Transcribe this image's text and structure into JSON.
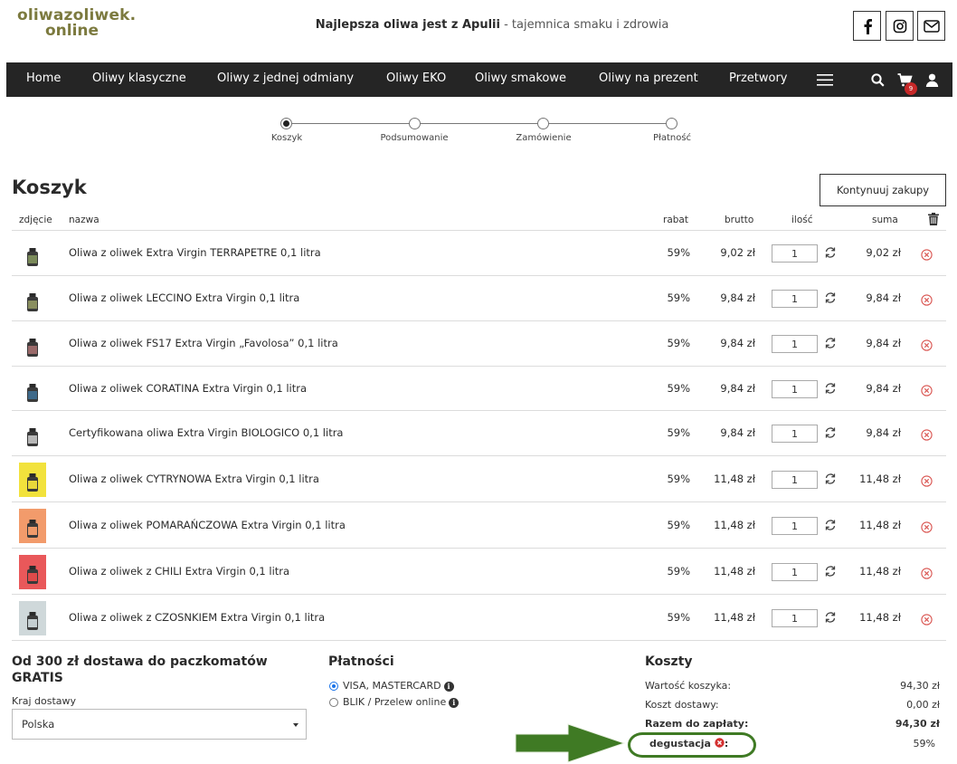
{
  "header": {
    "logo_line1": "oliwazoliwek.",
    "logo_line2": "online",
    "tagline_bold": "Najlepsza oliwa jest z Apulii",
    "tagline_rest": " - tajemnica smaku i zdrowia",
    "social": [
      "facebook-icon",
      "instagram-icon",
      "mail-icon"
    ]
  },
  "nav": {
    "items": [
      "Home",
      "Oliwy klasyczne",
      "Oliwy z jednej odmiany",
      "Oliwy EKO",
      "Oliwy smakowe",
      "Oliwy na prezent",
      "Przetwory"
    ],
    "cart_count": "9"
  },
  "steps": [
    "Koszyk",
    "Podsumowanie",
    "Zamówienie",
    "Płatność"
  ],
  "page_title": "Koszyk",
  "continue_label": "Kontynuuj zakupy",
  "table": {
    "headers": {
      "photo": "zdjęcie",
      "name": "nazwa",
      "rabat": "rabat",
      "brutto": "brutto",
      "qty": "ilość",
      "suma": "suma"
    },
    "rows": [
      {
        "name": "Oliwa z oliwek Extra Virgin TERRAPETRE 0,1 litra",
        "rabat": "59%",
        "brutto": "9,02 zł",
        "qty": "1",
        "suma": "9,02 zł",
        "label_color": "#7a8a5a",
        "bg": "#ffffff"
      },
      {
        "name": "Oliwa z oliwek LECCINO Extra Virgin 0,1 litra",
        "rabat": "59%",
        "brutto": "9,84 zł",
        "qty": "1",
        "suma": "9,84 zł",
        "label_color": "#8a8f60",
        "bg": "#ffffff"
      },
      {
        "name": "Oliwa z oliwek FS17 Extra Virgin „Favolosa” 0,1 litra",
        "rabat": "59%",
        "brutto": "9,84 zł",
        "qty": "1",
        "suma": "9,84 zł",
        "label_color": "#9a6a6a",
        "bg": "#ffffff"
      },
      {
        "name": "Oliwa z oliwek CORATINA Extra Virgin 0,1 litra",
        "rabat": "59%",
        "brutto": "9,84 zł",
        "qty": "1",
        "suma": "9,84 zł",
        "label_color": "#3f6a8a",
        "bg": "#ffffff"
      },
      {
        "name": "Certyfikowana oliwa Extra Virgin BIOLOGICO 0,1 litra",
        "rabat": "59%",
        "brutto": "9,84 zł",
        "qty": "1",
        "suma": "9,84 zł",
        "label_color": "#b8b8b8",
        "bg": "#ffffff"
      },
      {
        "name": "Oliwa z oliwek CYTRYNOWA Extra Virgin 0,1 litra",
        "rabat": "59%",
        "brutto": "11,48 zł",
        "qty": "1",
        "suma": "11,48 zł",
        "label_color": "#e8d83a",
        "bg": "#f2e23c"
      },
      {
        "name": "Oliwa z oliwek POMARAŃCZOWA Extra Virgin 0,1 litra",
        "rabat": "59%",
        "brutto": "11,48 zł",
        "qty": "1",
        "suma": "11,48 zł",
        "label_color": "#ef9a6a",
        "bg": "#f29b6b"
      },
      {
        "name": "Oliwa z oliwek z CHILI Extra Virgin 0,1 litra",
        "rabat": "59%",
        "brutto": "11,48 zł",
        "qty": "1",
        "suma": "11,48 zł",
        "label_color": "#e04a4a",
        "bg": "#e9585a"
      },
      {
        "name": "Oliwa z oliwek z CZOSNKIEM Extra Virgin 0,1 litra",
        "rabat": "59%",
        "brutto": "11,48 zł",
        "qty": "1",
        "suma": "11,48 zł",
        "label_color": "#c5cfd2",
        "bg": "#cfd8da"
      }
    ]
  },
  "delivery": {
    "title": "Od 300 zł dostawa do paczkomatów GRATIS",
    "country_label": "Kraj dostawy",
    "country_value": "Polska"
  },
  "payments": {
    "title": "Płatności",
    "options": [
      "VISA, MASTERCARD",
      "BLIK / Przelew online"
    ],
    "selected": 0
  },
  "costs": {
    "title": "Koszty",
    "cart_value_label": "Wartość koszyka:",
    "cart_value": "94,30 zł",
    "shipping_label": "Koszt dostawy:",
    "shipping_value": "0,00 zł",
    "total_label": "Razem do zapłaty:",
    "total_value": "94,30 zł",
    "discount_label": "degustacja",
    "discount_suffix": ":",
    "discount_value": "59%"
  },
  "colors": {
    "nav_bg": "#252525",
    "logo": "#7c7a3f",
    "remove_icon": "#d9534f",
    "highlight": "#3f7a24"
  }
}
